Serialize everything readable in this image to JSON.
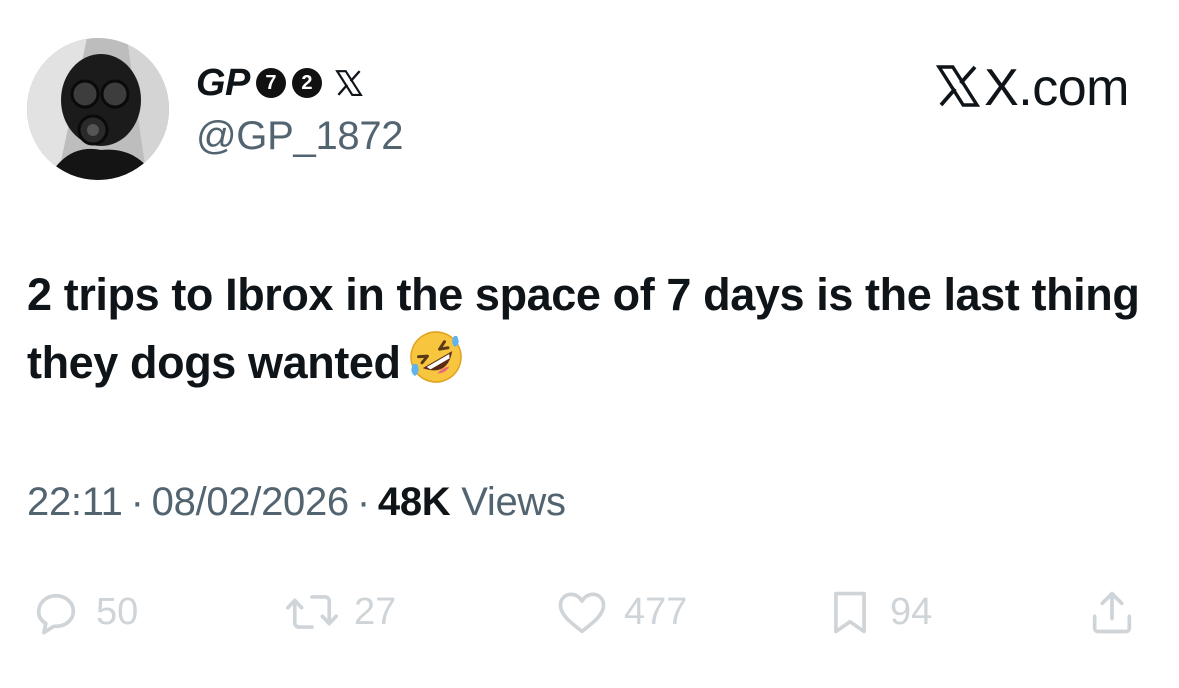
{
  "author": {
    "display_name": "GP",
    "badges": [
      "7",
      "2"
    ],
    "handle": "@GP_1872",
    "avatar": "gas-mask-avatar"
  },
  "brand": {
    "label": "X.com"
  },
  "tweet": {
    "text": "2 trips to Ibrox in the space of 7 days is the last thing they dogs wanted",
    "emoji": "rolling-on-floor-laughing",
    "time": "22:11",
    "date": "08/02/2026",
    "views_count": "48K",
    "views_label": "Views",
    "separator": "·"
  },
  "actions": {
    "replies": "50",
    "retweets": "27",
    "likes": "477",
    "bookmarks": "94"
  },
  "colors": {
    "text": "#0f1419",
    "secondary": "#536471",
    "action": "#cfd4d8"
  }
}
